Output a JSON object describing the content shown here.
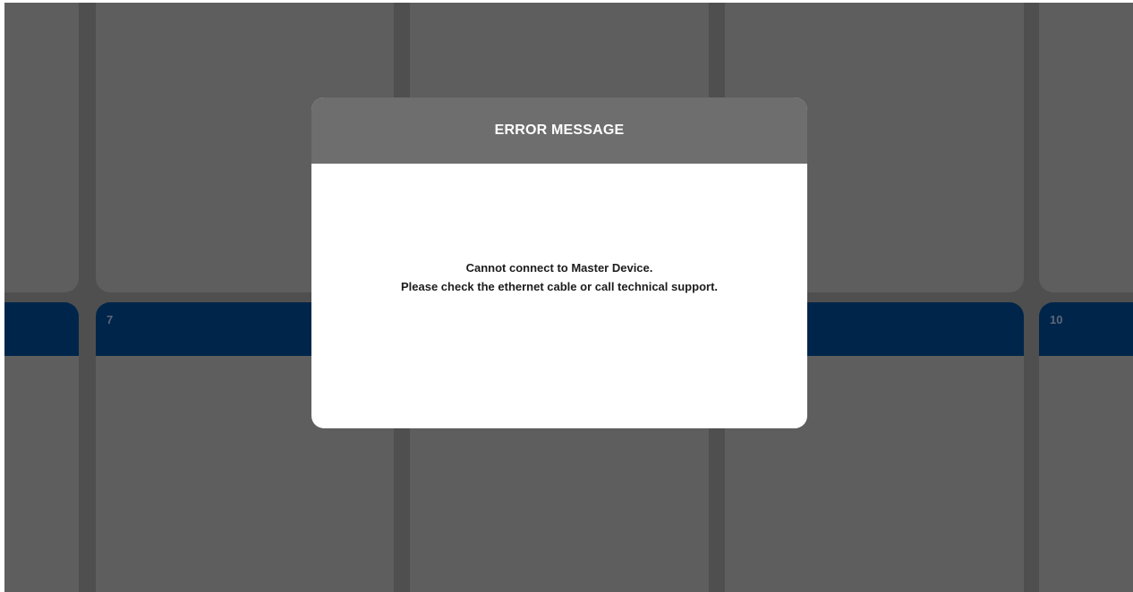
{
  "grid": {
    "tiles": [
      {
        "number": ""
      },
      {
        "number": "7"
      },
      {
        "number": ""
      },
      {
        "number": ""
      },
      {
        "number": "10"
      }
    ],
    "colors": {
      "background": "#4f4f4f",
      "tile": "#5e5e5e",
      "tile_header": "#00254a"
    }
  },
  "dialog": {
    "title": "ERROR MESSAGE",
    "message_line_1": "Cannot connect to Master Device.",
    "message_line_2": "Please check the ethernet cable or call technical support.",
    "colors": {
      "header": "#6e6e6e",
      "body": "#ffffff"
    }
  }
}
